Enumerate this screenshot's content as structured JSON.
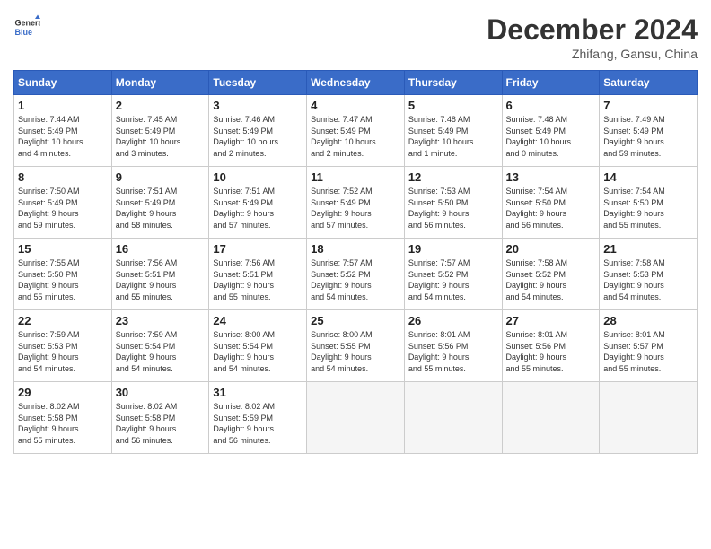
{
  "header": {
    "logo_line1": "General",
    "logo_line2": "Blue",
    "month_year": "December 2024",
    "location": "Zhifang, Gansu, China"
  },
  "weekdays": [
    "Sunday",
    "Monday",
    "Tuesday",
    "Wednesday",
    "Thursday",
    "Friday",
    "Saturday"
  ],
  "weeks": [
    [
      {
        "day": "1",
        "info": "Sunrise: 7:44 AM\nSunset: 5:49 PM\nDaylight: 10 hours\nand 4 minutes."
      },
      {
        "day": "2",
        "info": "Sunrise: 7:45 AM\nSunset: 5:49 PM\nDaylight: 10 hours\nand 3 minutes."
      },
      {
        "day": "3",
        "info": "Sunrise: 7:46 AM\nSunset: 5:49 PM\nDaylight: 10 hours\nand 2 minutes."
      },
      {
        "day": "4",
        "info": "Sunrise: 7:47 AM\nSunset: 5:49 PM\nDaylight: 10 hours\nand 2 minutes."
      },
      {
        "day": "5",
        "info": "Sunrise: 7:48 AM\nSunset: 5:49 PM\nDaylight: 10 hours\nand 1 minute."
      },
      {
        "day": "6",
        "info": "Sunrise: 7:48 AM\nSunset: 5:49 PM\nDaylight: 10 hours\nand 0 minutes."
      },
      {
        "day": "7",
        "info": "Sunrise: 7:49 AM\nSunset: 5:49 PM\nDaylight: 9 hours\nand 59 minutes."
      }
    ],
    [
      {
        "day": "8",
        "info": "Sunrise: 7:50 AM\nSunset: 5:49 PM\nDaylight: 9 hours\nand 59 minutes."
      },
      {
        "day": "9",
        "info": "Sunrise: 7:51 AM\nSunset: 5:49 PM\nDaylight: 9 hours\nand 58 minutes."
      },
      {
        "day": "10",
        "info": "Sunrise: 7:51 AM\nSunset: 5:49 PM\nDaylight: 9 hours\nand 57 minutes."
      },
      {
        "day": "11",
        "info": "Sunrise: 7:52 AM\nSunset: 5:49 PM\nDaylight: 9 hours\nand 57 minutes."
      },
      {
        "day": "12",
        "info": "Sunrise: 7:53 AM\nSunset: 5:50 PM\nDaylight: 9 hours\nand 56 minutes."
      },
      {
        "day": "13",
        "info": "Sunrise: 7:54 AM\nSunset: 5:50 PM\nDaylight: 9 hours\nand 56 minutes."
      },
      {
        "day": "14",
        "info": "Sunrise: 7:54 AM\nSunset: 5:50 PM\nDaylight: 9 hours\nand 55 minutes."
      }
    ],
    [
      {
        "day": "15",
        "info": "Sunrise: 7:55 AM\nSunset: 5:50 PM\nDaylight: 9 hours\nand 55 minutes."
      },
      {
        "day": "16",
        "info": "Sunrise: 7:56 AM\nSunset: 5:51 PM\nDaylight: 9 hours\nand 55 minutes."
      },
      {
        "day": "17",
        "info": "Sunrise: 7:56 AM\nSunset: 5:51 PM\nDaylight: 9 hours\nand 55 minutes."
      },
      {
        "day": "18",
        "info": "Sunrise: 7:57 AM\nSunset: 5:52 PM\nDaylight: 9 hours\nand 54 minutes."
      },
      {
        "day": "19",
        "info": "Sunrise: 7:57 AM\nSunset: 5:52 PM\nDaylight: 9 hours\nand 54 minutes."
      },
      {
        "day": "20",
        "info": "Sunrise: 7:58 AM\nSunset: 5:52 PM\nDaylight: 9 hours\nand 54 minutes."
      },
      {
        "day": "21",
        "info": "Sunrise: 7:58 AM\nSunset: 5:53 PM\nDaylight: 9 hours\nand 54 minutes."
      }
    ],
    [
      {
        "day": "22",
        "info": "Sunrise: 7:59 AM\nSunset: 5:53 PM\nDaylight: 9 hours\nand 54 minutes."
      },
      {
        "day": "23",
        "info": "Sunrise: 7:59 AM\nSunset: 5:54 PM\nDaylight: 9 hours\nand 54 minutes."
      },
      {
        "day": "24",
        "info": "Sunrise: 8:00 AM\nSunset: 5:54 PM\nDaylight: 9 hours\nand 54 minutes."
      },
      {
        "day": "25",
        "info": "Sunrise: 8:00 AM\nSunset: 5:55 PM\nDaylight: 9 hours\nand 54 minutes."
      },
      {
        "day": "26",
        "info": "Sunrise: 8:01 AM\nSunset: 5:56 PM\nDaylight: 9 hours\nand 55 minutes."
      },
      {
        "day": "27",
        "info": "Sunrise: 8:01 AM\nSunset: 5:56 PM\nDaylight: 9 hours\nand 55 minutes."
      },
      {
        "day": "28",
        "info": "Sunrise: 8:01 AM\nSunset: 5:57 PM\nDaylight: 9 hours\nand 55 minutes."
      }
    ],
    [
      {
        "day": "29",
        "info": "Sunrise: 8:02 AM\nSunset: 5:58 PM\nDaylight: 9 hours\nand 55 minutes."
      },
      {
        "day": "30",
        "info": "Sunrise: 8:02 AM\nSunset: 5:58 PM\nDaylight: 9 hours\nand 56 minutes."
      },
      {
        "day": "31",
        "info": "Sunrise: 8:02 AM\nSunset: 5:59 PM\nDaylight: 9 hours\nand 56 minutes."
      },
      null,
      null,
      null,
      null
    ]
  ]
}
